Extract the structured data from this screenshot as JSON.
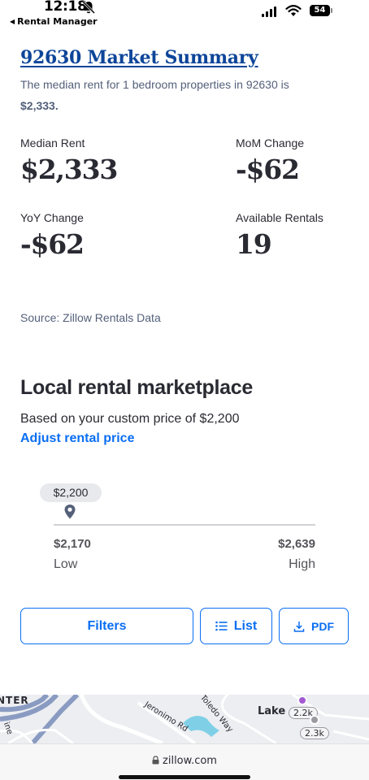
{
  "status_bar": {
    "time": "12:18",
    "back_app": "Rental Manager",
    "battery": "54"
  },
  "summary": {
    "title": "92630 Market Summary",
    "desc_prefix": "The median rent for 1 bedroom properties in 92630 is",
    "desc_value": "$2,333."
  },
  "stats": {
    "median_rent_label": "Median Rent",
    "median_rent_value": "$2,333",
    "mom_label": "MoM Change",
    "mom_value": "-$62",
    "yoy_label": "YoY Change",
    "yoy_value": "-$62",
    "available_label": "Available Rentals",
    "available_value": "19"
  },
  "source": "Source: Zillow Rentals Data",
  "marketplace": {
    "title": "Local rental marketplace",
    "subtitle": "Based on your custom price of $2,200",
    "adjust_link": "Adjust rental price",
    "price_pill": "$2,200",
    "low_value": "$2,170",
    "low_label": "Low",
    "high_value": "$2,639",
    "high_label": "High",
    "marker_fraction": 0.064
  },
  "buttons": {
    "filters": "Filters",
    "list": "List",
    "pdf": "PDF"
  },
  "map": {
    "label_center": "NTER",
    "label_road1": "Jeronimo Rd",
    "label_road2": "Toledo Way",
    "label_lake": "Lake",
    "badge1": "2.2k",
    "badge2": "2.3k",
    "label_edge": "ine"
  },
  "url_bar": {
    "url": "zillow.com"
  },
  "colors": {
    "link_blue": "#0b6ef2",
    "title_blue": "#0d4599",
    "text_dark": "#2a2a33",
    "text_muted": "#54607a"
  }
}
